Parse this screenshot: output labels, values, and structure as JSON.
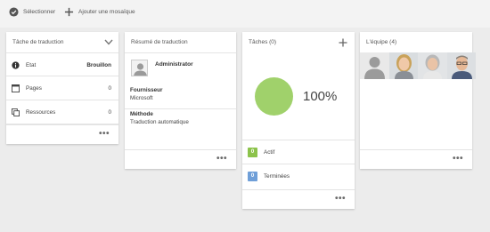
{
  "toolbar": {
    "select_label": "Sélectionner",
    "add_tile_label": "Ajouter une mosaïque"
  },
  "cards": {
    "translation_task": {
      "title": "Tâche de traduction",
      "rows": [
        {
          "icon": "info-icon",
          "label": "Etat",
          "value": "Brouillon"
        },
        {
          "icon": "pages-icon",
          "label": "Pages",
          "value": "0"
        },
        {
          "icon": "resources-icon",
          "label": "Ressources",
          "value": "0"
        }
      ],
      "more": "•••"
    },
    "translation_summary": {
      "title": "Résumé de traduction",
      "user_name": "Administrator",
      "provider_label": "Fournisseur",
      "provider_value": "Microsoft",
      "method_label": "Méthode",
      "method_value": "Traduction automatique",
      "more": "•••"
    },
    "tasks": {
      "title": "Tâches (0)",
      "percent": "100%",
      "percent_value": 1.0,
      "active_count": "0",
      "active_label": "Actif",
      "done_count": "0",
      "done_label": "Terminées",
      "more": "•••"
    },
    "team": {
      "title": "L'équipe (4)",
      "members": [
        "placeholder-avatar",
        "woman-blonde-avatar",
        "woman-gray-avatar",
        "man-glasses-avatar"
      ],
      "more": "•••"
    }
  },
  "colors": {
    "background": "#ececec",
    "progress": "#a0d16b",
    "active_badge": "#8cc34b",
    "done_badge": "#6f9fd8"
  }
}
